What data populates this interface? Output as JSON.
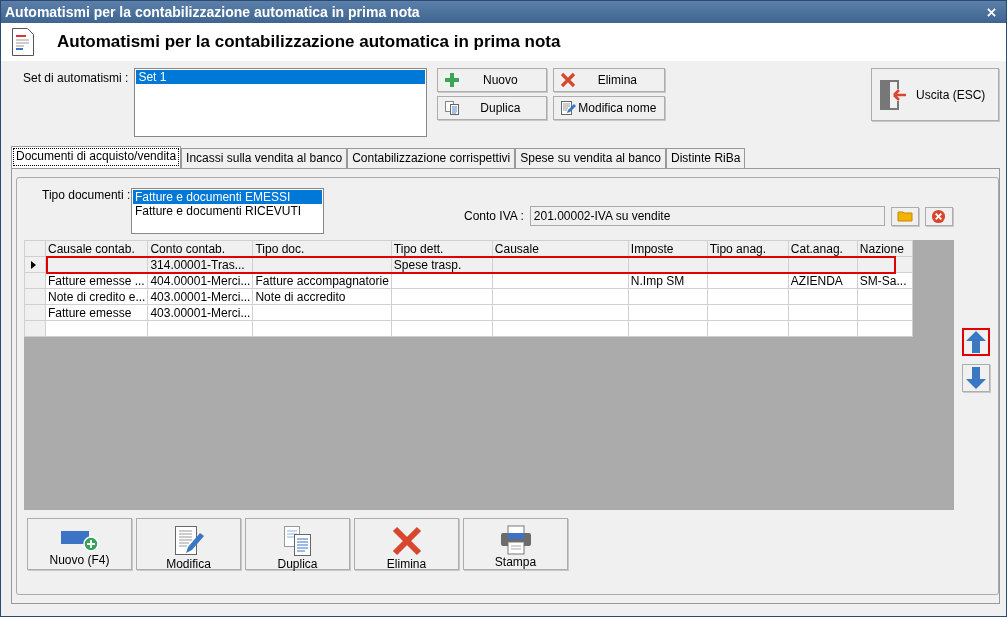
{
  "window": {
    "title": "Automatismi per la contabilizzazione automatica in prima nota"
  },
  "header": {
    "title": "Automatismi per la contabilizzazione automatica in prima nota"
  },
  "set": {
    "label": "Set di automatismi :",
    "items": [
      {
        "text": "Set 1",
        "selected": true
      }
    ]
  },
  "set_buttons": [
    {
      "label": "Nuovo",
      "kind": "plus"
    },
    {
      "label": "Elimina",
      "kind": "x"
    },
    {
      "label": "Duplica",
      "kind": "copy"
    },
    {
      "label": "Modifica nome",
      "kind": "edit"
    }
  ],
  "exit_button": {
    "label": "Uscita (ESC)"
  },
  "tabs": [
    {
      "label": "Documenti di acquisto/vendita",
      "selected": true
    },
    {
      "label": "Incassi sulla vendita al banco",
      "selected": false
    },
    {
      "label": "Contabilizzazione corrispettivi",
      "selected": false
    },
    {
      "label": "Spese su vendita al banco",
      "selected": false
    },
    {
      "label": "Distinte RiBa",
      "selected": false
    }
  ],
  "tipo_documenti": {
    "label": "Tipo documenti :",
    "items": [
      {
        "text": "Fatture e documenti EMESSI",
        "selected": true
      },
      {
        "text": "Fatture e documenti RICEVUTI",
        "selected": false
      }
    ]
  },
  "conto_iva": {
    "label": "Conto IVA :",
    "value": "201.00002-IVA su vendite"
  },
  "table": {
    "columns": [
      "Causale contab.",
      "Conto contab.",
      "Tipo doc.",
      "Tipo dett.",
      "Causale",
      "Imposte",
      "Tipo anag.",
      "Cat.anag.",
      "Nazione"
    ],
    "rows": [
      {
        "current": true,
        "highlighted": true,
        "cells": [
          "",
          "314.00001-Tras...",
          "",
          "Spese trasp.",
          "",
          "",
          "",
          "",
          ""
        ]
      },
      {
        "current": false,
        "highlighted": false,
        "cells": [
          "Fatture emesse ...",
          "404.00001-Merci...",
          "Fatture accompagnatorie",
          "",
          "",
          "N.Imp SM",
          "",
          "AZIENDA",
          "SM-Sa..."
        ]
      },
      {
        "current": false,
        "highlighted": false,
        "cells": [
          "Note di credito e...",
          "403.00001-Merci...",
          "Note di accredito",
          "",
          "",
          "",
          "",
          "",
          ""
        ]
      },
      {
        "current": false,
        "highlighted": false,
        "cells": [
          "Fatture emesse",
          "403.00001-Merci...",
          "",
          "",
          "",
          "",
          "",
          "",
          ""
        ]
      },
      {
        "current": false,
        "highlighted": false,
        "cells": [
          "",
          "",
          "",
          "",
          "",
          "",
          "",
          "",
          ""
        ]
      }
    ]
  },
  "move_buttons": [
    {
      "kind": "up",
      "highlighted": true
    },
    {
      "kind": "down",
      "highlighted": false
    }
  ],
  "bottom_buttons": [
    {
      "label": "Nuovo (F4)",
      "kind": "new"
    },
    {
      "label": "Modifica",
      "kind": "edit"
    },
    {
      "label": "Duplica",
      "kind": "copy"
    },
    {
      "label": "Elimina",
      "kind": "x"
    },
    {
      "label": "Stampa",
      "kind": "print"
    }
  ]
}
